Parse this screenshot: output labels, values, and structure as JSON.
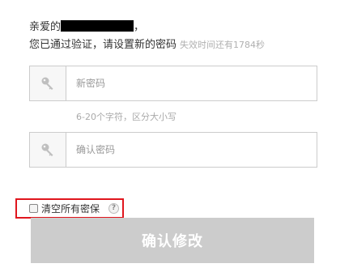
{
  "greeting": {
    "prefix": "亲爱的",
    "suffix": "，"
  },
  "notice": {
    "text": "您已通过验证，请设置新的密码",
    "expiry": "失效时间还有1784秒"
  },
  "new_password": {
    "placeholder": "新密码",
    "icon": "key-icon"
  },
  "hint": "6-20个字符，区分大小写",
  "confirm_password": {
    "placeholder": "确认密码",
    "icon": "key-icon"
  },
  "clear_security": {
    "label": "清空所有密保",
    "checked": false,
    "help_icon": "question-icon",
    "help_glyph": "?"
  },
  "submit": {
    "label": "确认修改"
  },
  "colors": {
    "highlight": "#e0161e",
    "button_disabled": "#cccccc"
  }
}
